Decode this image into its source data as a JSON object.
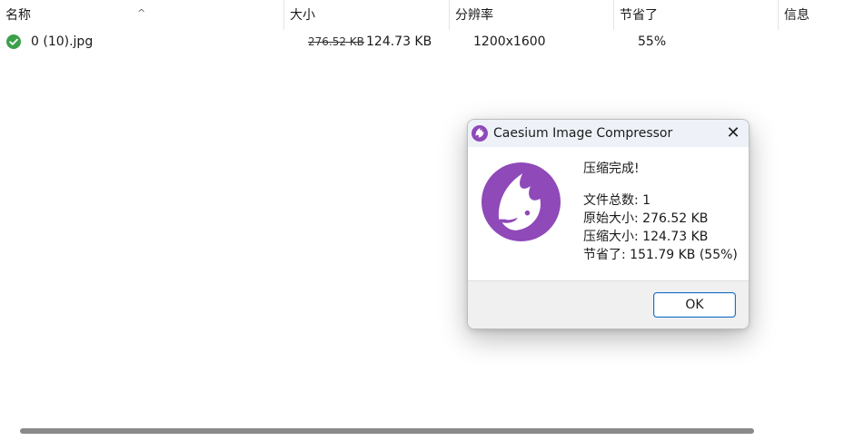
{
  "table": {
    "columns": [
      {
        "label": "名称"
      },
      {
        "label": "大小"
      },
      {
        "label": "分辨率"
      },
      {
        "label": "节省了"
      },
      {
        "label": "信息"
      }
    ],
    "rows": [
      {
        "status": "success-check-icon",
        "name": "0 (10).jpg",
        "original_size": "276.52 KB",
        "new_size": "124.73 KB",
        "resolution": "1200x1600",
        "saved": "55%"
      }
    ]
  },
  "dialog": {
    "title": "Caesium Image Compressor",
    "heading": "压缩完成!",
    "lines": [
      "文件总数: 1",
      "原始大小: 276.52 KB",
      "压缩大小: 124.73 KB",
      "节省了: 151.79 KB (55%)"
    ],
    "ok_label": "OK",
    "close_glyph": "✕"
  },
  "colors": {
    "success": "#3ca04a",
    "brand_purple": "#8f49b8",
    "accent": "#1e6fc3"
  }
}
